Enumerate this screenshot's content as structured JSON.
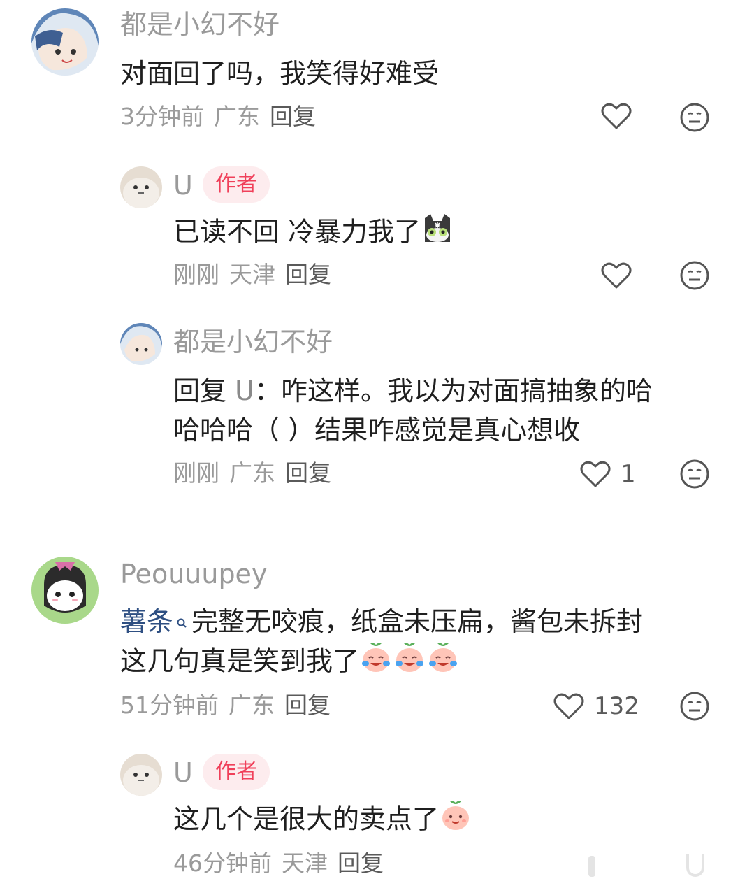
{
  "comments": [
    {
      "user": "都是小幻不好",
      "text": "对面回了吗，我笑得好难受",
      "time": "3分钟前",
      "location": "广东",
      "reply_label": "回复"
    },
    {
      "user": "U",
      "badge": "作者",
      "text": "已读不回 冷暴力我了",
      "time": "刚刚",
      "location": "天津",
      "reply_label": "回复"
    },
    {
      "user": "都是小幻不好",
      "reply_prefix": "回复",
      "mention": "U",
      "mention_sep": "：",
      "line1": "咋这样。我以为对面搞抽象的哈",
      "line2": "哈哈哈（ ）结果咋感觉是真心想收",
      "time": "刚刚",
      "location": "广东",
      "reply_label": "回复",
      "likes": "1"
    },
    {
      "user": "Peouuupey",
      "topic": "薯条",
      "line1": "完整无咬痕，纸盒未压扁，酱包未拆封",
      "line2": "这几句真是笑到我了",
      "time": "51分钟前",
      "location": "广东",
      "reply_label": "回复",
      "likes": "132"
    },
    {
      "user": "U",
      "badge": "作者",
      "text": "这几个是很大的卖点了",
      "time": "46分钟前",
      "location": "天津",
      "reply_label": "回复"
    }
  ],
  "icons": {
    "like": "heart-outline-icon",
    "dislike": "meh-face-icon",
    "search": "search-small-icon",
    "emoji_cat": "cat-emoji",
    "emoji_cry_laugh": "peach-cry-laugh-emoji",
    "emoji_smile": "peach-smile-emoji"
  },
  "colors": {
    "badge_bg": "#fdecee",
    "badge_text": "#f0405a",
    "topic": "#2e4f82",
    "muted": "#9a9a9a"
  }
}
